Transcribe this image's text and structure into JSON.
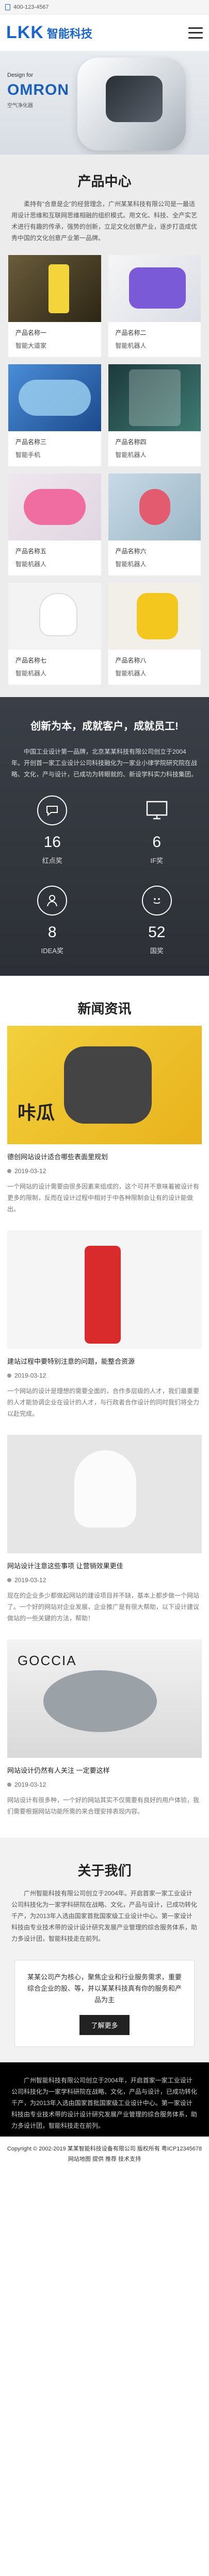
{
  "topbar": {
    "phone": "400-123-4567"
  },
  "header": {
    "logo_mark": "LKK",
    "logo_text": "智能科技"
  },
  "banner": {
    "design_for": "Design for",
    "brand": "OMRON",
    "brand_sub": "空气净化器"
  },
  "products": {
    "title": "产品中心",
    "intro": "柔持有“合意是企”的经营理念，广州某某科技有限公司是一最适用设计思维和互联网思维相融的组织模式。用文化、科技、全产实艺术进行有趣的传承，强势的创新，立足文化创意产业，逐步打造成优秀中国的文化创意产业第一品牌。",
    "items": [
      {
        "name": "产品名称一",
        "cat": "智能大道家"
      },
      {
        "name": "产品名称二",
        "cat": "智能机器人"
      },
      {
        "name": "产品名称三",
        "cat": "智能手机"
      },
      {
        "name": "产品名称四",
        "cat": "智能机器人"
      },
      {
        "name": "产品名称五",
        "cat": "智能机器人"
      },
      {
        "name": "产品名称六",
        "cat": "智能机器人"
      },
      {
        "name": "产品名称七",
        "cat": "智能机器人"
      },
      {
        "name": "产品名称八",
        "cat": "智能机器人"
      }
    ]
  },
  "dark": {
    "title": "创新为本，成就客户，成就员工!",
    "text": "中国工业设计第一品牌，北京某某科技有限公司创立于2004年。开创首一家工业设计公司科技融化为一家业小律学院研究院在战略、文化，产与设计，已成功为转眼就的、新设学科实力科技集团。",
    "stats": [
      {
        "icon": "chat-bubble-icon",
        "num": "16",
        "label": "红点奖"
      },
      {
        "icon": "monitor-icon",
        "num": "6",
        "label": "IF奖"
      },
      {
        "icon": "person-icon",
        "num": "8",
        "label": "IDEA奖"
      },
      {
        "icon": "smile-icon",
        "num": "52",
        "label": "国奖"
      }
    ]
  },
  "news": {
    "title": "新闻资讯",
    "items": [
      {
        "img_label": "咔瓜",
        "title": "德创网站设计适合哪些表面里规划",
        "date": "2019-03-12",
        "excerpt": "一个网站的设计需要由很多因素来组成的，这个可并不意味着被设计有更多的限制，反而在设计过程中相对于中各种限制会让有的设计能做出。"
      },
      {
        "img_label": "",
        "title": "建站过程中要特别注意的问题，能整合资源",
        "date": "2019-03-12",
        "excerpt": "一个网站的设计是理想的需要全面的，合作多层级的人才，我们最重要的人才能协调企业在设计的人才，与行政者合作设计的同时我们将全力以赴完成。"
      },
      {
        "img_label": "",
        "title": "网站设计注意这些事项 让营销效果更佳",
        "date": "2019-03-12",
        "excerpt": "现在的企业多少都做起网站的建设项目并不缺，基本上都步做一个网站了。一个好的网站对企业发展，企业推广是有很大帮助，以下设计建议做站的一些关键的方法，帮助！"
      },
      {
        "img_label": "GOCCIA",
        "title": "网站设计仍然有人关注 一定要这样",
        "date": "2019-03-12",
        "excerpt": "网站设计有很多种，一个好的网站其实不仅需要有良好的用户体验，我们需要根据网站功能所需的来合理安排表现内容。"
      }
    ]
  },
  "about": {
    "title": "关于我们",
    "text": "广州智能科技有限公司创立于2004年。开启首家一家工业设计公司科技化为一家学科研院在战略、文化，产品与设计，已成功转化千产，为2013年入选由国家首批国家级工业设计中心。第一家设计科技由专业技术带的设计设计研究发展产业管理的综合服务体系，助力多设计团，智能科技走在前列。",
    "box_text": "某某公司产为核心，聚焦企业和行业服务需求，重要综合企业的股、等，并以某某科技真有你的服务和产品为主",
    "more_label": "了解更多"
  },
  "footer": {
    "text": "广州智能科技有限公司创立于2004年，开启首家一家工业设计公司科技化为一家学科研院在战略、文化，产品与设计，已成功转化千产，为2013年入选由国家首批国家级工业设计中心。第一家设计科技由专业技术带的设计设计研究发展产业管理的综合服务体系，助力多设计团，智能科技走在前列。",
    "copyright": "Copyright © 2002-2019 某某智能科技设备有限公司 版权所有 粤ICP12345678 网站地图 提供 推荐 技术支持"
  }
}
